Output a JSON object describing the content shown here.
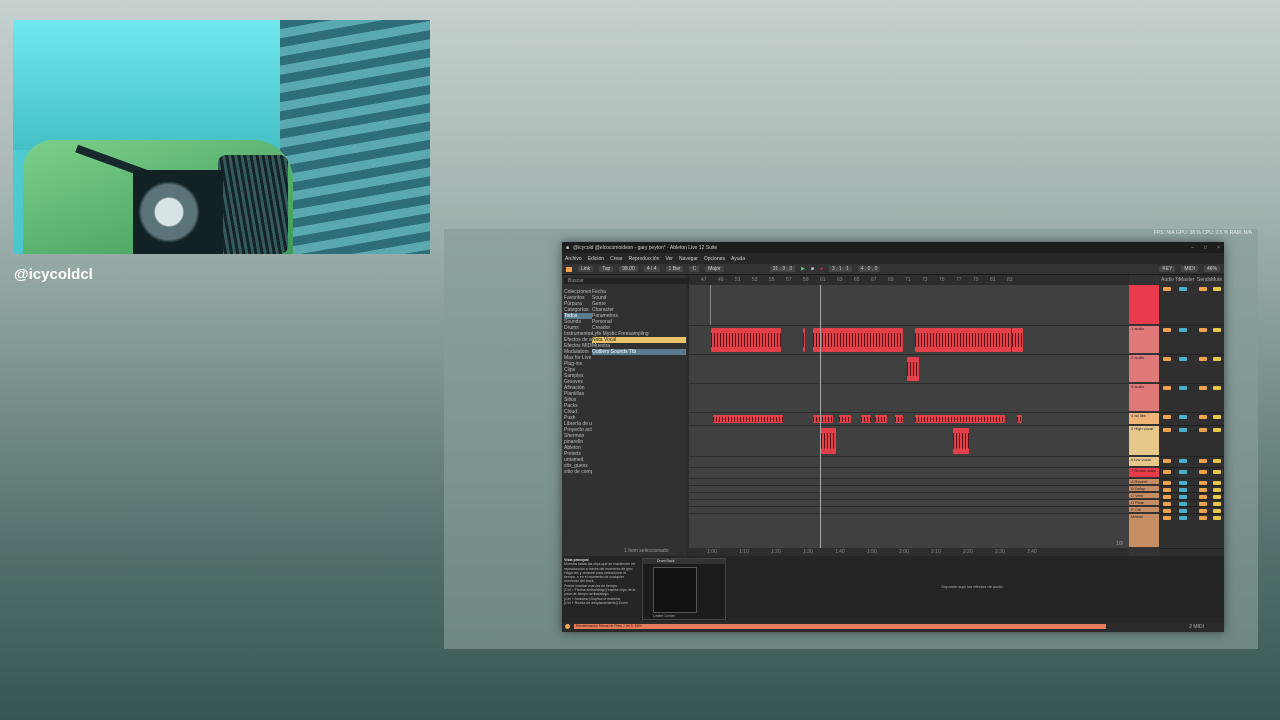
{
  "webcam": {
    "handle": "@icycoldcl"
  },
  "stats": "FPS: N/A   GPU: 38 %   CPU: 0.5 %   RAM: N/A",
  "ableton": {
    "window_title": "@icycold @elcocomoidesn - gary peyton* - Ableton Live 12 Suite",
    "window_controls": [
      "–",
      "□",
      "×"
    ],
    "menu": [
      "Archivo",
      "Edición",
      "Crear",
      "Reproducción",
      "Ver",
      "Navegar",
      "Opciones",
      "Ayuda"
    ],
    "transport": {
      "link": "Link",
      "tap": "Tap",
      "tempo": "98.00",
      "signature": "4 / 4",
      "metro": "1 Bar",
      "key": "C",
      "scale": "Major",
      "position": "31 . 3 . 3",
      "loop_start": "3 . 1 . 1",
      "loop_len": "4 . 0 . 0",
      "cpu": "46%",
      "key_label": "KEY",
      "midi_label": "MIDI"
    },
    "browser": {
      "search": "Buscar",
      "collections_title": "Colecciones",
      "collections": [
        "Favoritos",
        "Púrpura"
      ],
      "categories_title": "Categorías",
      "categories": [
        "Todos",
        "Sounds",
        "Drums",
        "Instrumentos",
        "Efectos de audio",
        "Efectos MIDI",
        "Modulators",
        "Max for Live",
        "Plug-ins",
        "Clips",
        "Samples",
        "Grooves",
        "Afinación",
        "Plantillas"
      ],
      "places_title": "Sitios",
      "places": [
        "Packs",
        "Cloud",
        "Push",
        "Librería de usuario",
        "Proyecto actual",
        "Sherman",
        "pinarello",
        "Ableton",
        "Presets",
        "untamed",
        "stix_guess",
        "sitio de comp"
      ],
      "files_col": [
        "Fecha",
        "Sound",
        "Genre",
        "Character",
        "Parametros",
        "Personal",
        "Creador",
        "Lyfe Mystic Freesampling",
        "Nota Vocal",
        "Muestra",
        "Outliers Sounds Ttb"
      ],
      "footer": "1 ítem seleccionado"
    },
    "arrangement": {
      "ruler": [
        "47",
        "49",
        "51",
        "53",
        "55",
        "57",
        "59",
        "61",
        "63",
        "65",
        "67",
        "69",
        "71",
        "73",
        "75",
        "77",
        "79",
        "81",
        "83"
      ],
      "timeline": [
        "1:00",
        "1:10",
        "1:20",
        "1:30",
        "1:40",
        "1:50",
        "2:00",
        "2:10",
        "2:20",
        "2:30",
        "2:40"
      ],
      "counter": "1/2"
    },
    "tracks": [
      {
        "name": "",
        "color": "#e83c4c"
      },
      {
        "name": "1 audio",
        "color": "#e07a7a"
      },
      {
        "name": "2 audio",
        "color": "#e07a7a"
      },
      {
        "name": "3 audio",
        "color": "#e07a7a"
      },
      {
        "name": "4 ad libs",
        "color": "#f0b47a"
      },
      {
        "name": "5 High vocal",
        "color": "#e8c88a"
      },
      {
        "name": "6 low vocal",
        "color": "#e8c88a"
      },
      {
        "name": "7 Drums stats",
        "color": "#e83c4c"
      },
      {
        "name": "A Reverb",
        "color": "#c78d63"
      },
      {
        "name": "B Delay",
        "color": "#c78d63"
      },
      {
        "name": "C Verb",
        "color": "#c78d63"
      },
      {
        "name": "D Plate",
        "color": "#c78d63"
      },
      {
        "name": "E Ctrl",
        "color": "#c78d63"
      },
      {
        "name": "Master",
        "color": "#c78d63"
      }
    ],
    "mixer_labels": [
      "Audio To",
      "Master",
      "Sends",
      "Mute"
    ],
    "info": {
      "title": "Vista principal",
      "lines": [
        "Muestra todas las clips que se mantienen en reproducción a través del momento de giro.",
        "Haga clic y arrastre para seleccionar el tiempo, o en el momento de cualquier momento del track.",
        "Puede insertar marcas de tiempo.",
        "[Ctrl + Flecha arriba/abajo] Inserta clips de la pista de tiempo arriba/abajo.",
        "[Ctrl + Arrastrar] Duplica el material.",
        "[Ctrl + Rueda de desplazamiento] Zoom"
      ]
    },
    "device": {
      "name": "Drum Rack",
      "footer": "Limiter   Limiter"
    },
    "drop_hint": "Deposite aquí los efectos de audio",
    "status": "Renderizando Marca de Pista 2 de 8: 68%",
    "bottom_right": "2 MIDI"
  }
}
